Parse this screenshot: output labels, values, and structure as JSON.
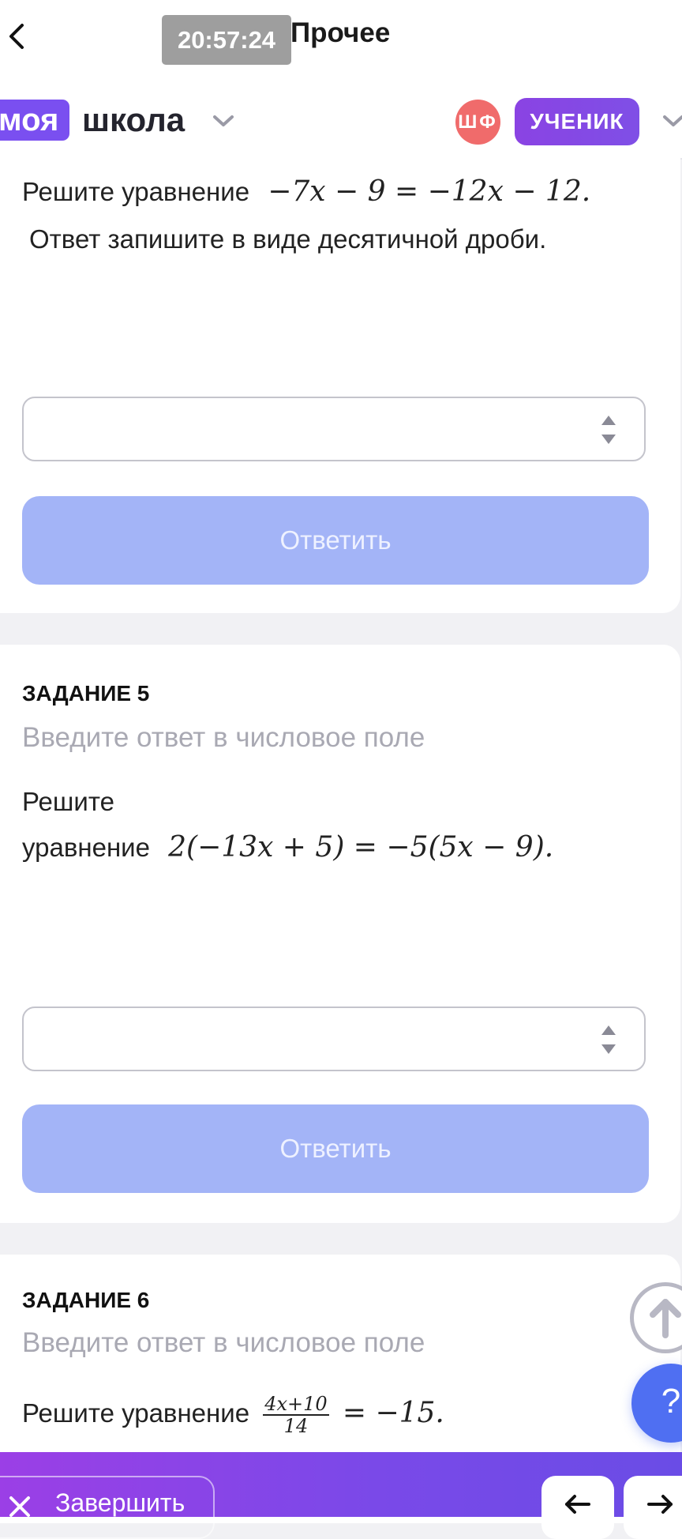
{
  "status": {
    "time": "20:57:24",
    "title": "Прочее"
  },
  "header": {
    "logo_part1": "моя",
    "logo_part2": "школа",
    "avatar_initials": "ШФ",
    "role": "УЧЕНИК"
  },
  "task4": {
    "question_prefix": "Решите уравнение",
    "equation": "−7x − 9 = −12x − 12.",
    "instruction": "Ответ запишите в виде десятичной дроби.",
    "answer_value": "",
    "answer_button": "Ответить"
  },
  "task5": {
    "title": "ЗАДАНИЕ 5",
    "hint": "Введите ответ в числовое поле",
    "question_line1": "Решите",
    "question_line2": "уравнение",
    "equation": "2(−13x + 5) = −5(5x − 9).",
    "answer_value": "",
    "answer_button": "Ответить"
  },
  "task6": {
    "title": "ЗАДАНИЕ 6",
    "hint": "Введите ответ в числовое поле",
    "question_prefix": "Решите уравнение",
    "fraction_numerator": "4x+10",
    "fraction_denominator": "14",
    "equation_rhs": "= −15."
  },
  "help": {
    "label": "?"
  },
  "footer": {
    "finish_label": "Завершить"
  },
  "colors": {
    "accent": "#7a4ff0",
    "button_disabled": "#a3b4f7",
    "avatar": "#f06b6b",
    "help": "#4f6ff2"
  }
}
